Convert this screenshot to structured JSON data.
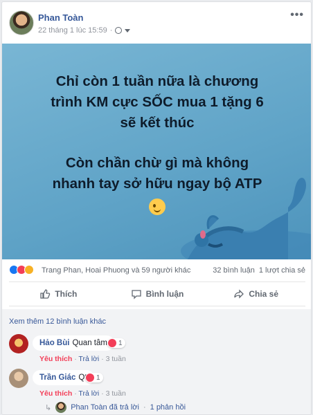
{
  "post": {
    "author": "Phan Toàn",
    "timestamp": "22 tháng 1 lúc 15:59",
    "privacy_sep": "·",
    "more_label": "•••"
  },
  "banner": {
    "line1": "Chỉ còn 1 tuần nữa là chương",
    "line2": "trình KM cực SỐC mua 1 tặng 6",
    "line3": "sẽ kết thúc",
    "line4": "Còn chần chừ gì mà không",
    "line5": "nhanh tay sở hữu ngay bộ ATP"
  },
  "reactions": {
    "names": "Trang Phan, Hoai Phuong và 59 người khác",
    "comments_count": "32 bình luận",
    "shares_count": "1 lượt chia sẻ"
  },
  "actions": {
    "like": "Thích",
    "comment": "Bình luận",
    "share": "Chia sẻ"
  },
  "comments": {
    "see_more": "Xem thêm 12 bình luận khác",
    "items": [
      {
        "name": "Hảo Bùi",
        "text": "Quan tâm",
        "reaction_count": "1",
        "like": "Yêu thích",
        "sep": "·",
        "reply": "Trả lời",
        "time": "3 tuần"
      },
      {
        "name": "Trần Giác",
        "text": "Qt",
        "reaction_count": "1",
        "like": "Yêu thích",
        "sep": "·",
        "reply": "Trả lời",
        "time": "3 tuần"
      }
    ],
    "reply_summary": {
      "text": "Phan Toàn đã trả lời",
      "sep": "·",
      "count": "1 phản hồi"
    }
  },
  "colors": {
    "link": "#365899",
    "banner_bg": "#5fa3c7",
    "love": "#f33e58",
    "like_blue": "#1877f2"
  }
}
